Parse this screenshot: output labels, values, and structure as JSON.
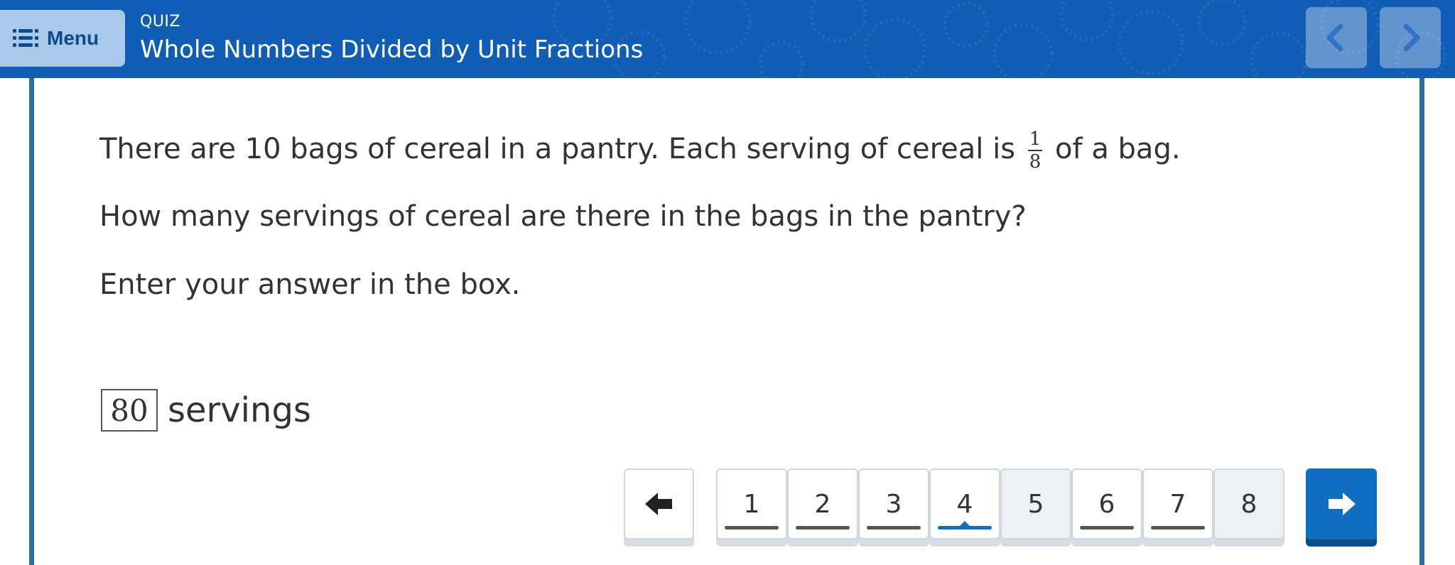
{
  "header": {
    "menu_label": "Menu",
    "quiz_label": "QUIZ",
    "title": "Whole Numbers Divided by Unit Fractions"
  },
  "question": {
    "line1_before": "There are 10 bags of cereal in a pantry. Each serving of cereal is",
    "fraction_numerator": "1",
    "fraction_denominator": "8",
    "line1_after": "of a bag.",
    "line2": "How many servings of cereal are there in the bags in the pantry?",
    "line3": "Enter your answer in the box."
  },
  "answer": {
    "value": "80",
    "unit": "servings"
  },
  "pager": {
    "pages": [
      {
        "label": "1",
        "answered": true,
        "current": false
      },
      {
        "label": "2",
        "answered": true,
        "current": false
      },
      {
        "label": "3",
        "answered": true,
        "current": false
      },
      {
        "label": "4",
        "answered": true,
        "current": true
      },
      {
        "label": "5",
        "answered": false,
        "current": false
      },
      {
        "label": "6",
        "answered": true,
        "current": false
      },
      {
        "label": "7",
        "answered": true,
        "current": false
      },
      {
        "label": "8",
        "answered": false,
        "current": false
      }
    ]
  },
  "colors": {
    "header_bg": "#0f5db5",
    "accent": "#0f6ec0",
    "frame": "#2f6ea3",
    "menu_bg": "#a9c9ea"
  },
  "icons": {
    "menu": "hamburger-icon",
    "header_prev": "chevron-left-icon",
    "header_next": "chevron-right-icon",
    "pager_back": "arrow-left-icon",
    "pager_next": "arrow-right-icon"
  }
}
